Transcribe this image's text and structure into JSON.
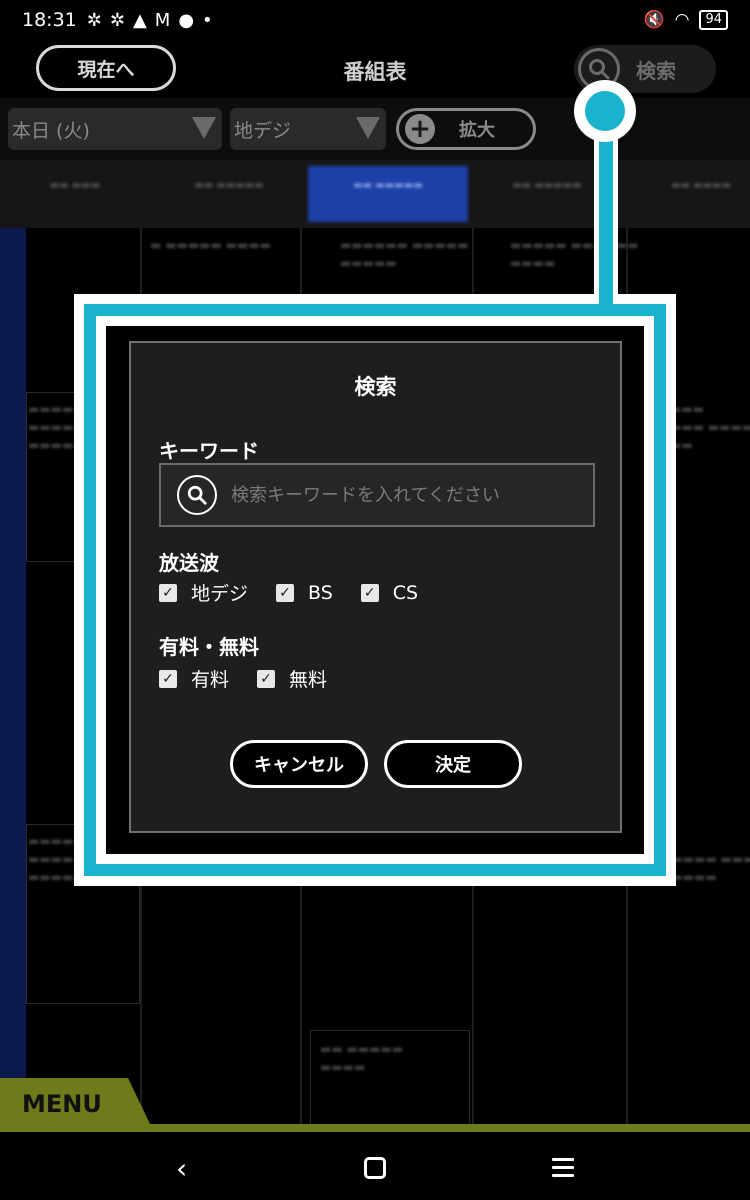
{
  "status_bar": {
    "time": "18:31",
    "icons": [
      "gear-icon",
      "gear-icon",
      "alert-icon",
      "mail-icon",
      "keyhole-icon",
      "dot-icon"
    ],
    "battery": "94"
  },
  "header": {
    "now_button": "現在へ",
    "title": "番組表",
    "search_button": "検索"
  },
  "filters": {
    "day_select": "本日 (火)",
    "broadcast_select": "地デジ",
    "zoom_button": "拡大"
  },
  "menu": {
    "label": "MENU",
    "accent_color": "#6f7a1a"
  },
  "callout": {
    "color": "#1ab3cf"
  },
  "dialog": {
    "title": "検索",
    "keyword_label": "キーワード",
    "keyword_placeholder": "検索キーワードを入れてください",
    "keyword_value": "",
    "broadcast_label": "放送波",
    "broadcast_options": [
      {
        "label": "地デジ",
        "checked": true
      },
      {
        "label": "BS",
        "checked": true
      },
      {
        "label": "CS",
        "checked": true
      }
    ],
    "fee_label": "有料・無料",
    "fee_options": [
      {
        "label": "有料",
        "checked": true
      },
      {
        "label": "無料",
        "checked": true
      }
    ],
    "cancel_button": "キャンセル",
    "confirm_button": "決定"
  }
}
